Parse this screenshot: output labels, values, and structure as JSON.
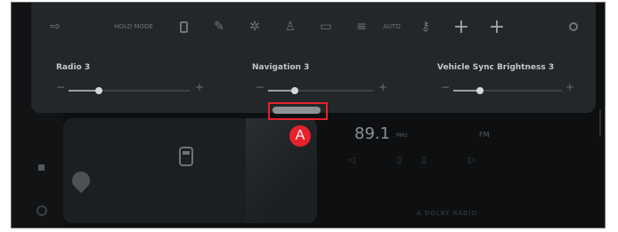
{
  "colors": {
    "panel": "#232729",
    "background": "#0d0f10",
    "callout": "#e6212b"
  },
  "topbar": {
    "items": [
      {
        "icon": "cast-icon",
        "glyph": "⇨"
      },
      {
        "icon": "hold-button",
        "label": "HOLD MODE"
      },
      {
        "icon": "phone-icon"
      },
      {
        "icon": "pen-icon",
        "glyph": "✎"
      },
      {
        "icon": "fan-icon",
        "glyph": "✲"
      },
      {
        "icon": "seat-icon",
        "glyph": "♙"
      },
      {
        "icon": "screen-icon",
        "glyph": "▭"
      },
      {
        "icon": "list-icon",
        "glyph": "≡"
      },
      {
        "icon": "auto-button",
        "label": "AUTO"
      },
      {
        "icon": "key-icon",
        "glyph": "⚷"
      },
      {
        "icon": "plus-icon-1",
        "glyph": "+"
      },
      {
        "icon": "plus-icon-2",
        "glyph": "+"
      },
      {
        "icon": "settings-icon",
        "glyph": "⚙"
      }
    ]
  },
  "sliders": [
    {
      "label": "Radio 3",
      "minus": "−",
      "plus": "+",
      "level": 0.25
    },
    {
      "label": "Navigation 3",
      "minus": "−",
      "plus": "+",
      "level": 0.25
    },
    {
      "label": "Vehicle Sync Brightness 3",
      "minus": "−",
      "plus": "+",
      "level": 0.25
    }
  ],
  "radio": {
    "frequency": "89.1",
    "unit": "MHz",
    "tag": "FM",
    "controls": "◁ ▯▯ ▷",
    "footer": "A DOLBY RADIO"
  },
  "callout": {
    "label": "A"
  }
}
